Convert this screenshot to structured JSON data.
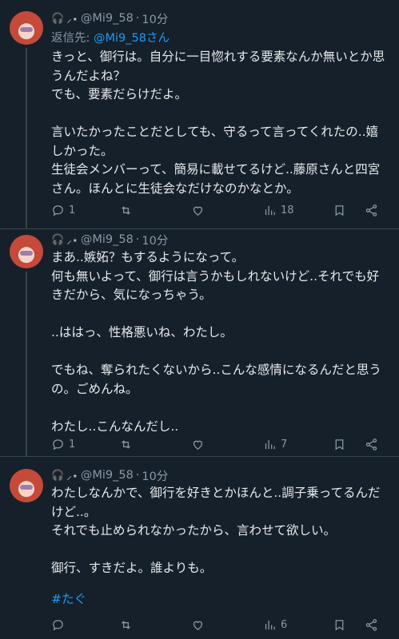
{
  "tweets": [
    {
      "header": {
        "handle": "@Mi9_58",
        "sep": "·",
        "time": "10分"
      },
      "reply_label": "返信先: ",
      "reply_handle": "@Mi9_58さん",
      "text": "きっと、御行は。自分に一目惚れする要素なんか無いとか思うんだよね？\nでも、要素だらけだよ。\n\n言いたかったことだとしても、守るって言ってくれたの..嬉しかった。\n生徒会メンバーって、簡易に載せてるけど..藤原さんと四宮さん。ほんとに生徒会なだけなのかなとか。",
      "counts": {
        "reply": "1",
        "retweet": "",
        "like": "",
        "views": "18"
      }
    },
    {
      "header": {
        "handle": "@Mi9_58",
        "sep": "·",
        "time": "10分"
      },
      "text": "まあ..嫉妬？もするようになって。\n何も無いよって、御行は言うかもしれないけど..それでも好きだから、気になっちゃう。\n\n..ははっ、性格悪いね、わたし。\n\nでもね、奪られたくないから..こんな感情になるんだと思うの。ごめんね。\n\nわたし..こんなんだし..",
      "counts": {
        "reply": "1",
        "retweet": "",
        "like": "",
        "views": "7"
      }
    },
    {
      "header": {
        "handle": "@Mi9_58",
        "sep": "·",
        "time": "10分"
      },
      "text": "わたしなんかで、御行を好きとかほんと..調子乗ってるんだけど..。\nそれでも止められなかったから、言わせて欲しい。\n\n御行、すきだよ。誰よりも。",
      "hashtag": "#たぐ",
      "counts": {
        "reply": "",
        "retweet": "",
        "like": "",
        "views": "6"
      }
    }
  ],
  "icons": [
    "headphones-icon",
    "sparkle-wand-icon",
    "reply-icon",
    "retweet-icon",
    "like-icon",
    "views-icon",
    "bookmark-icon",
    "share-icon"
  ],
  "colors": {
    "background": "#15202b",
    "text": "#e7e9ea",
    "muted": "#8b98a5",
    "link": "#1d9bf0",
    "divider": "#38444d"
  }
}
